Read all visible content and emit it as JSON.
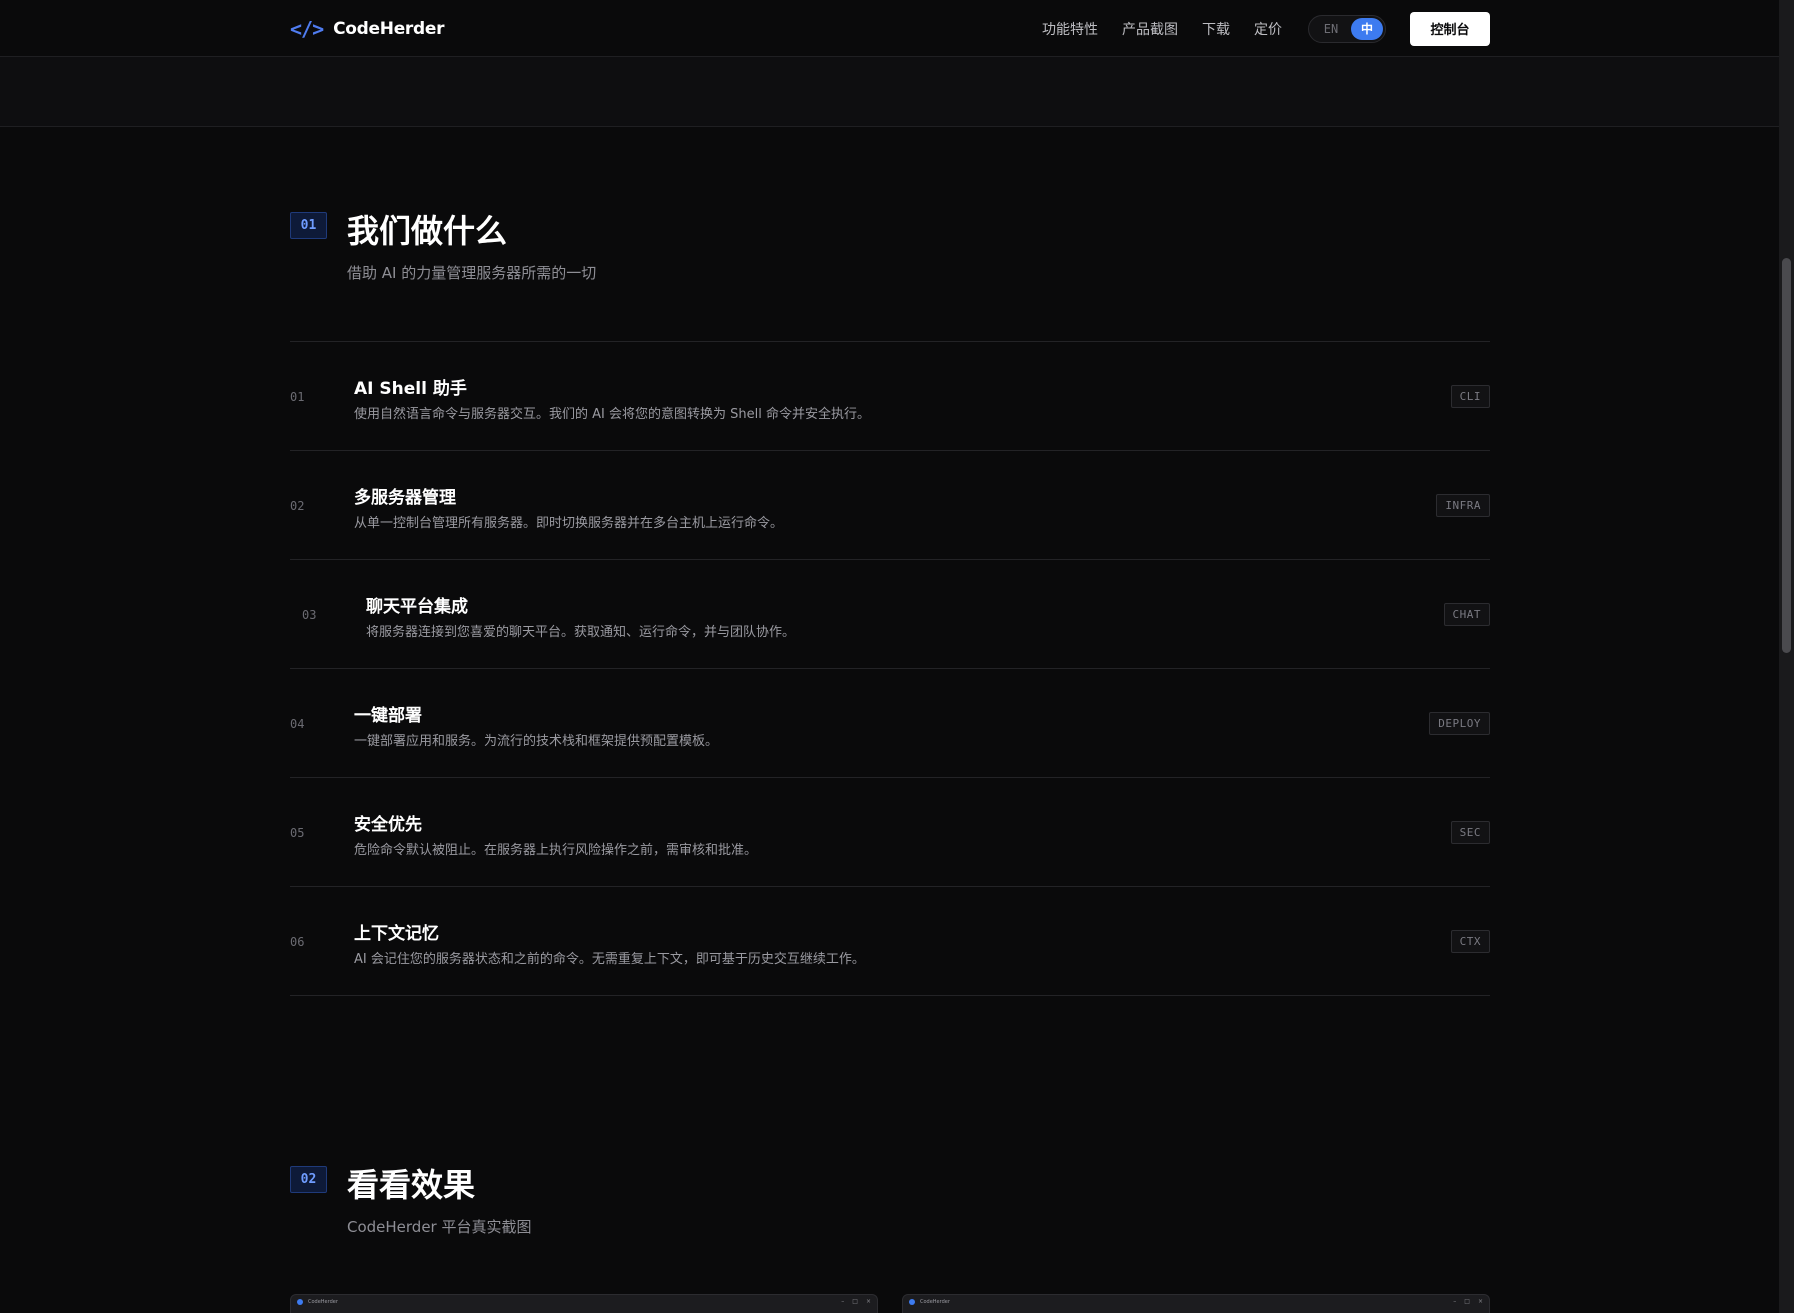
{
  "header": {
    "logo_mark": "</>",
    "logo_text": "CodeHerder",
    "nav": [
      "功能特性",
      "产品截图",
      "下载",
      "定价"
    ],
    "lang_en": "EN",
    "lang_zh": "中",
    "console_label": "控制台"
  },
  "section1": {
    "num": "01",
    "title": "我们做什么",
    "subtitle": "借助 AI 的力量管理服务器所需的一切"
  },
  "features": [
    {
      "num": "01",
      "title": "AI Shell 助手",
      "desc": "使用自然语言命令与服务器交互。我们的 AI 会将您的意图转换为 Shell 命令并安全执行。",
      "tag": "CLI"
    },
    {
      "num": "02",
      "title": "多服务器管理",
      "desc": "从单一控制台管理所有服务器。即时切换服务器并在多台主机上运行命令。",
      "tag": "INFRA"
    },
    {
      "num": "03",
      "title": "聊天平台集成",
      "desc": "将服务器连接到您喜爱的聊天平台。获取通知、运行命令，并与团队协作。",
      "tag": "CHAT"
    },
    {
      "num": "04",
      "title": "一键部署",
      "desc": "一键部署应用和服务。为流行的技术栈和框架提供预配置模板。",
      "tag": "DEPLOY"
    },
    {
      "num": "05",
      "title": "安全优先",
      "desc": "危险命令默认被阻止。在服务器上执行风险操作之前，需审核和批准。",
      "tag": "SEC"
    },
    {
      "num": "06",
      "title": "上下文记忆",
      "desc": "AI 会记住您的服务器状态和之前的命令。无需重复上下文，即可基于历史交互继续工作。",
      "tag": "CTX"
    }
  ],
  "section2": {
    "num": "02",
    "title": "看看效果",
    "subtitle": "CodeHerder 平台真实截图"
  },
  "shots": [
    {
      "title": "CodeHerder"
    },
    {
      "title": "CodeHerder"
    }
  ],
  "colors": {
    "accent": "#3d7bf0",
    "background": "#0a0a0b"
  }
}
